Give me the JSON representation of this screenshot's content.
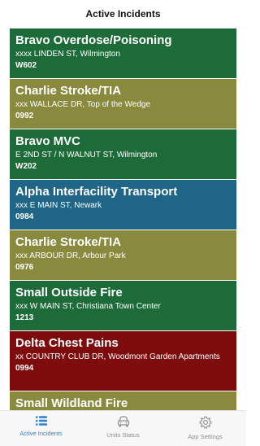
{
  "header": {
    "title": "Active Incidents"
  },
  "incidents": [
    {
      "title": "Bravo Overdose/Poisoning",
      "address": "xxxx LINDEN ST, Wilmington",
      "unit": "W602",
      "color": "#1e6b3a"
    },
    {
      "title": "Charlie Stroke/TIA",
      "address": "xxx WALLACE DR, Top of the Wedge",
      "unit": "0992",
      "color": "#898a3e"
    },
    {
      "title": "Bravo MVC",
      "address": "E 2ND ST / N WALNUT ST, Wilmington",
      "unit": "W202",
      "color": "#1e6b3a"
    },
    {
      "title": "Alpha Interfacility Transport",
      "address": "xxx E MAIN ST, Newark",
      "unit": "0984",
      "color": "#1f6585"
    },
    {
      "title": "Charlie Stroke/TIA",
      "address": "xxx ARBOUR DR, Arbour Park",
      "unit": "0976",
      "color": "#898a3e"
    },
    {
      "title": "Small Outside Fire",
      "address": "xxx W MAIN ST, Christiana Town Center",
      "unit": "1213",
      "color": "#1e6b3a"
    },
    {
      "title": "Delta Chest Pains",
      "address": "xx COUNTRY CLUB DR, Woodmont Garden Apartments",
      "unit": "0994",
      "color": "#7e0c0c"
    },
    {
      "title": "Small Wildland Fire",
      "address": "",
      "unit": "",
      "color": "#898a3e"
    }
  ],
  "tabs": [
    {
      "label": "Active Incidents",
      "icon": "list-icon",
      "active": true
    },
    {
      "label": "Units Status",
      "icon": "car-icon",
      "active": false
    },
    {
      "label": "App Settings",
      "icon": "gear-icon",
      "active": false
    }
  ],
  "colors": {
    "accent": "#2f80d1",
    "inactive_tab": "#8e8e93"
  }
}
